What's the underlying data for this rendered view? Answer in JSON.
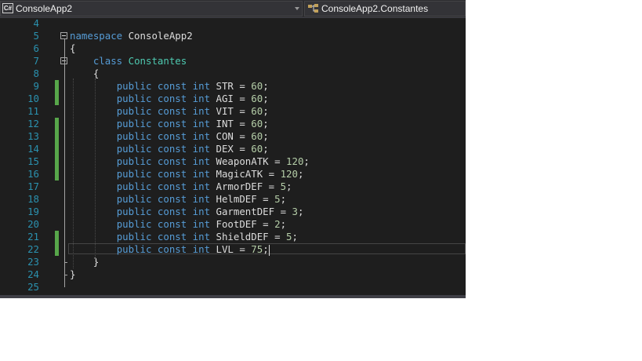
{
  "navbar": {
    "project_icon": "C#",
    "project_label": "ConsoleApp2",
    "class_label": "ConsoleApp2.Constantes",
    "class_icon": "class-icon"
  },
  "colors": {
    "keyword": "#569cd6",
    "type": "#4ec9b0",
    "number": "#b5cea8",
    "line_number": "#2b91af",
    "change_marker": "#57a64a"
  },
  "code": {
    "lines": [
      {
        "n": "4",
        "changed": false,
        "fold": false,
        "tokens": []
      },
      {
        "n": "5",
        "changed": false,
        "fold": true,
        "tokens": [
          {
            "t": "kw",
            "v": "namespace"
          },
          {
            "t": "plain",
            "v": " ConsoleApp2"
          }
        ]
      },
      {
        "n": "6",
        "changed": false,
        "fold": false,
        "tokens": [
          {
            "t": "plain",
            "v": "{"
          }
        ]
      },
      {
        "n": "7",
        "changed": false,
        "fold": true,
        "tokens": [
          {
            "t": "plain",
            "v": "    "
          },
          {
            "t": "kw",
            "v": "class"
          },
          {
            "t": "plain",
            "v": " "
          },
          {
            "t": "type",
            "v": "Constantes"
          }
        ]
      },
      {
        "n": "8",
        "changed": false,
        "fold": false,
        "tokens": [
          {
            "t": "plain",
            "v": "    {"
          }
        ]
      },
      {
        "n": "9",
        "changed": true,
        "fold": false,
        "tokens": [
          {
            "t": "plain",
            "v": "        "
          },
          {
            "t": "kw",
            "v": "public const int"
          },
          {
            "t": "plain",
            "v": " STR = "
          },
          {
            "t": "num",
            "v": "60"
          },
          {
            "t": "plain",
            "v": ";"
          }
        ]
      },
      {
        "n": "10",
        "changed": true,
        "fold": false,
        "tokens": [
          {
            "t": "plain",
            "v": "        "
          },
          {
            "t": "kw",
            "v": "public const int"
          },
          {
            "t": "plain",
            "v": " AGI = "
          },
          {
            "t": "num",
            "v": "60"
          },
          {
            "t": "plain",
            "v": ";"
          }
        ]
      },
      {
        "n": "11",
        "changed": false,
        "fold": false,
        "tokens": [
          {
            "t": "plain",
            "v": "        "
          },
          {
            "t": "kw",
            "v": "public const int"
          },
          {
            "t": "plain",
            "v": " VIT = "
          },
          {
            "t": "num",
            "v": "60"
          },
          {
            "t": "plain",
            "v": ";"
          }
        ]
      },
      {
        "n": "12",
        "changed": true,
        "fold": false,
        "tokens": [
          {
            "t": "plain",
            "v": "        "
          },
          {
            "t": "kw",
            "v": "public const int"
          },
          {
            "t": "plain",
            "v": " INT = "
          },
          {
            "t": "num",
            "v": "60"
          },
          {
            "t": "plain",
            "v": ";"
          }
        ]
      },
      {
        "n": "13",
        "changed": true,
        "fold": false,
        "tokens": [
          {
            "t": "plain",
            "v": "        "
          },
          {
            "t": "kw",
            "v": "public const int"
          },
          {
            "t": "plain",
            "v": " CON = "
          },
          {
            "t": "num",
            "v": "60"
          },
          {
            "t": "plain",
            "v": ";"
          }
        ]
      },
      {
        "n": "14",
        "changed": true,
        "fold": false,
        "tokens": [
          {
            "t": "plain",
            "v": "        "
          },
          {
            "t": "kw",
            "v": "public const int"
          },
          {
            "t": "plain",
            "v": " DEX = "
          },
          {
            "t": "num",
            "v": "60"
          },
          {
            "t": "plain",
            "v": ";"
          }
        ]
      },
      {
        "n": "15",
        "changed": true,
        "fold": false,
        "tokens": [
          {
            "t": "plain",
            "v": "        "
          },
          {
            "t": "kw",
            "v": "public const int"
          },
          {
            "t": "plain",
            "v": " WeaponATK = "
          },
          {
            "t": "num",
            "v": "120"
          },
          {
            "t": "plain",
            "v": ";"
          }
        ]
      },
      {
        "n": "16",
        "changed": true,
        "fold": false,
        "tokens": [
          {
            "t": "plain",
            "v": "        "
          },
          {
            "t": "kw",
            "v": "public const int"
          },
          {
            "t": "plain",
            "v": " MagicATK = "
          },
          {
            "t": "num",
            "v": "120"
          },
          {
            "t": "plain",
            "v": ";"
          }
        ]
      },
      {
        "n": "17",
        "changed": false,
        "fold": false,
        "tokens": [
          {
            "t": "plain",
            "v": "        "
          },
          {
            "t": "kw",
            "v": "public const int"
          },
          {
            "t": "plain",
            "v": " ArmorDEF = "
          },
          {
            "t": "num",
            "v": "5"
          },
          {
            "t": "plain",
            "v": ";"
          }
        ]
      },
      {
        "n": "18",
        "changed": false,
        "fold": false,
        "tokens": [
          {
            "t": "plain",
            "v": "        "
          },
          {
            "t": "kw",
            "v": "public const int"
          },
          {
            "t": "plain",
            "v": " HelmDEF = "
          },
          {
            "t": "num",
            "v": "5"
          },
          {
            "t": "plain",
            "v": ";"
          }
        ]
      },
      {
        "n": "19",
        "changed": false,
        "fold": false,
        "tokens": [
          {
            "t": "plain",
            "v": "        "
          },
          {
            "t": "kw",
            "v": "public const int"
          },
          {
            "t": "plain",
            "v": " GarmentDEF = "
          },
          {
            "t": "num",
            "v": "3"
          },
          {
            "t": "plain",
            "v": ";"
          }
        ]
      },
      {
        "n": "20",
        "changed": false,
        "fold": false,
        "tokens": [
          {
            "t": "plain",
            "v": "        "
          },
          {
            "t": "kw",
            "v": "public const int"
          },
          {
            "t": "plain",
            "v": " FootDEF = "
          },
          {
            "t": "num",
            "v": "2"
          },
          {
            "t": "plain",
            "v": ";"
          }
        ]
      },
      {
        "n": "21",
        "changed": true,
        "fold": false,
        "tokens": [
          {
            "t": "plain",
            "v": "        "
          },
          {
            "t": "kw",
            "v": "public const int"
          },
          {
            "t": "plain",
            "v": " ShieldDEF = "
          },
          {
            "t": "num",
            "v": "5"
          },
          {
            "t": "plain",
            "v": ";"
          }
        ]
      },
      {
        "n": "22",
        "changed": true,
        "fold": false,
        "current": true,
        "tokens": [
          {
            "t": "plain",
            "v": "        "
          },
          {
            "t": "kw",
            "v": "public const int"
          },
          {
            "t": "plain",
            "v": " LVL = "
          },
          {
            "t": "num",
            "v": "75"
          },
          {
            "t": "plain",
            "v": ";"
          }
        ]
      },
      {
        "n": "23",
        "changed": false,
        "fold": false,
        "tokens": [
          {
            "t": "plain",
            "v": "    }"
          }
        ]
      },
      {
        "n": "24",
        "changed": false,
        "fold": false,
        "tokens": [
          {
            "t": "plain",
            "v": "}"
          }
        ]
      },
      {
        "n": "25",
        "changed": false,
        "fold": false,
        "tokens": []
      }
    ]
  }
}
